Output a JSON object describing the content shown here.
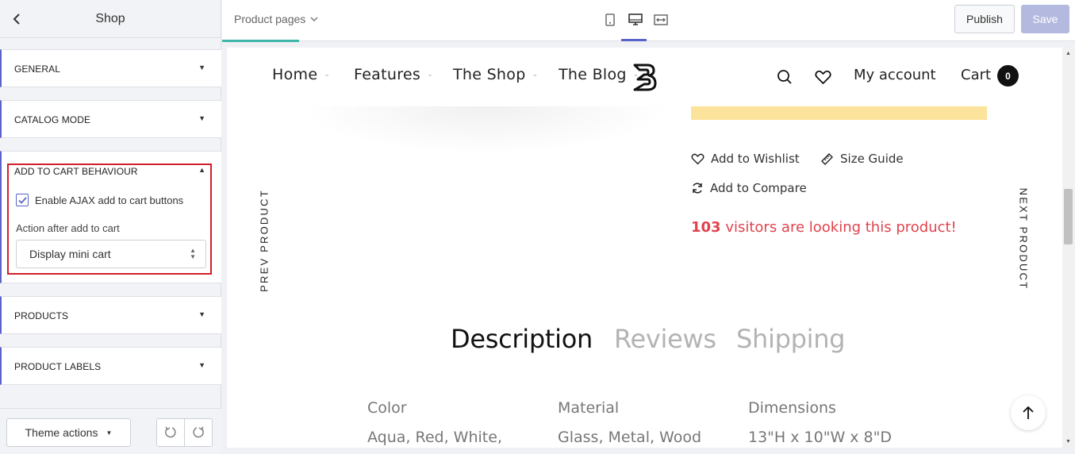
{
  "sidebar": {
    "title": "Shop",
    "sections": {
      "general": "GENERAL",
      "catalog_mode": "CATALOG MODE",
      "add_to_cart": "ADD TO CART BEHAVIOUR",
      "products": "PRODUCTS",
      "product_labels": "PRODUCT LABELS"
    },
    "add_to_cart": {
      "ajax_label": "Enable AJAX add to cart buttons",
      "ajax_checked": true,
      "action_label": "Action after add to cart",
      "action_value": "Display mini cart"
    },
    "footer": {
      "theme_actions": "Theme actions"
    }
  },
  "topbar": {
    "page_selector": "Product pages",
    "publish": "Publish",
    "save": "Save"
  },
  "preview": {
    "nav": {
      "home": "Home",
      "features": "Features",
      "shop": "The Shop",
      "blog": "The Blog",
      "my_account": "My account",
      "cart": "Cart",
      "cart_count": "0"
    },
    "actions": {
      "wishlist": "Add to Wishlist",
      "size_guide": "Size Guide",
      "compare": "Add to Compare"
    },
    "visitors": {
      "count": "103",
      "text": "visitors are looking this product!"
    },
    "prev_product": "PREV PRODUCT",
    "next_product": "NEXT PRODUCT",
    "tabs": [
      "Description",
      "Reviews",
      "Shipping"
    ],
    "attributes": [
      {
        "name": "Color",
        "value": "Aqua, Red, White,"
      },
      {
        "name": "Material",
        "value": "Glass, Metal, Wood"
      },
      {
        "name": "Dimensions",
        "value": "13\"H x 10\"W x 8\"D"
      }
    ]
  },
  "colors": {
    "accent": "#5b63c8",
    "highlight_border": "#d0202a",
    "visitors_red": "#e0434d",
    "yellow": "#fbe39b",
    "teal": "#3fb7a8"
  }
}
